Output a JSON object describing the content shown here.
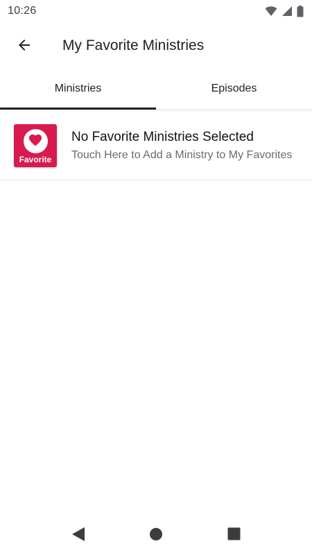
{
  "status_bar": {
    "time": "10:26",
    "icons": [
      "wifi-icon",
      "signal-icon",
      "battery-icon"
    ]
  },
  "app_bar": {
    "back_icon": "arrow-left-icon",
    "title": "My Favorite Ministries"
  },
  "tabs": [
    {
      "label": "Ministries",
      "active": true
    },
    {
      "label": "Episodes",
      "active": false
    }
  ],
  "list": {
    "items": [
      {
        "badge_icon": "heart-icon",
        "badge_label": "Favorite",
        "title": "No Favorite Ministries Selected",
        "subtitle": "Touch Here to Add a Ministry to My Favorites"
      }
    ]
  },
  "nav_bar": {
    "buttons": [
      "back-triangle-icon",
      "home-circle-icon",
      "recents-square-icon"
    ]
  },
  "colors": {
    "accent": "#d81b4e",
    "text_primary": "#202124",
    "text_secondary": "#6b6b6b",
    "tab_indicator": "#202124"
  }
}
